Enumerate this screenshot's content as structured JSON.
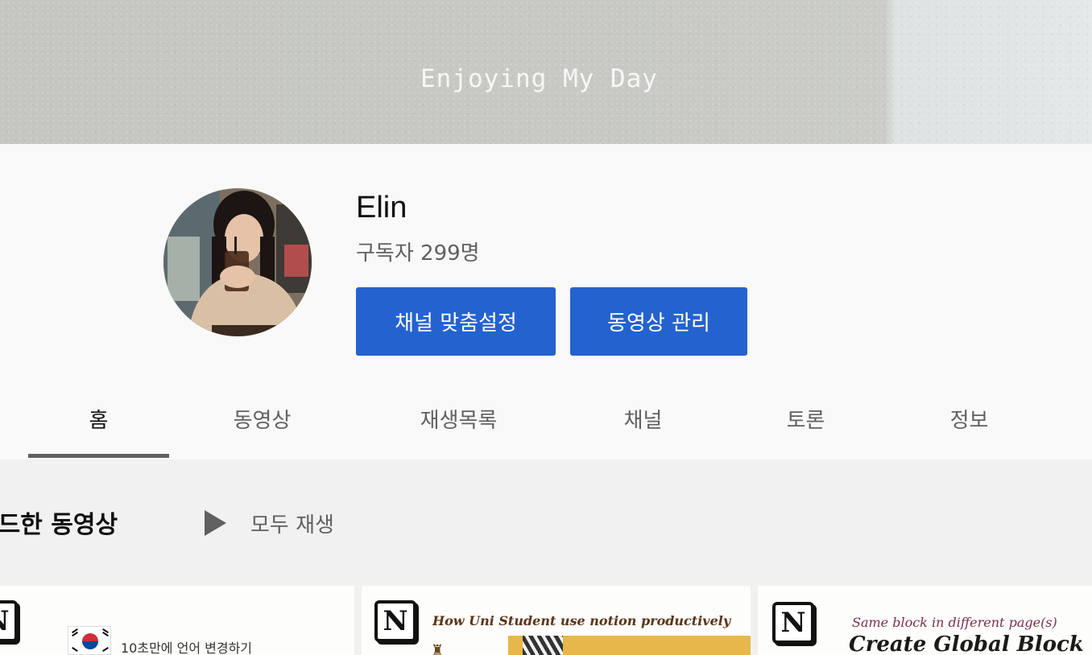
{
  "banner": {
    "text": "Enjoying My Day"
  },
  "channel": {
    "name": "Elin",
    "subscribers": "구독자 299명",
    "buttons": {
      "customize": "채널 맞춤설정",
      "manage": "동영상 관리"
    }
  },
  "tabs": [
    {
      "label": "홈",
      "active": true
    },
    {
      "label": "동영상",
      "active": false
    },
    {
      "label": "재생목록",
      "active": false
    },
    {
      "label": "채널",
      "active": false
    },
    {
      "label": "토론",
      "active": false
    },
    {
      "label": "정보",
      "active": false
    }
  ],
  "uploads": {
    "title": "로드한 동영상",
    "play_all": "모두 재생",
    "videos": [
      {
        "logo": "N",
        "caption": "10초만에 언어 변경하기"
      },
      {
        "logo": "N",
        "caption": "How Uni Student use notion productively"
      },
      {
        "logo": "N",
        "caption": "Same block in different page(s)",
        "title": "Create Global Block"
      }
    ]
  },
  "colors": {
    "primary_button": "#2462cf",
    "tab_underline": "#606060",
    "header_bg": "#f9f9f9",
    "page_bg": "#f1f1f1"
  },
  "icons": {
    "play_all": "play-icon",
    "thumb_logo": "notion-logo-icon",
    "flag": "korean-flag-icon"
  }
}
